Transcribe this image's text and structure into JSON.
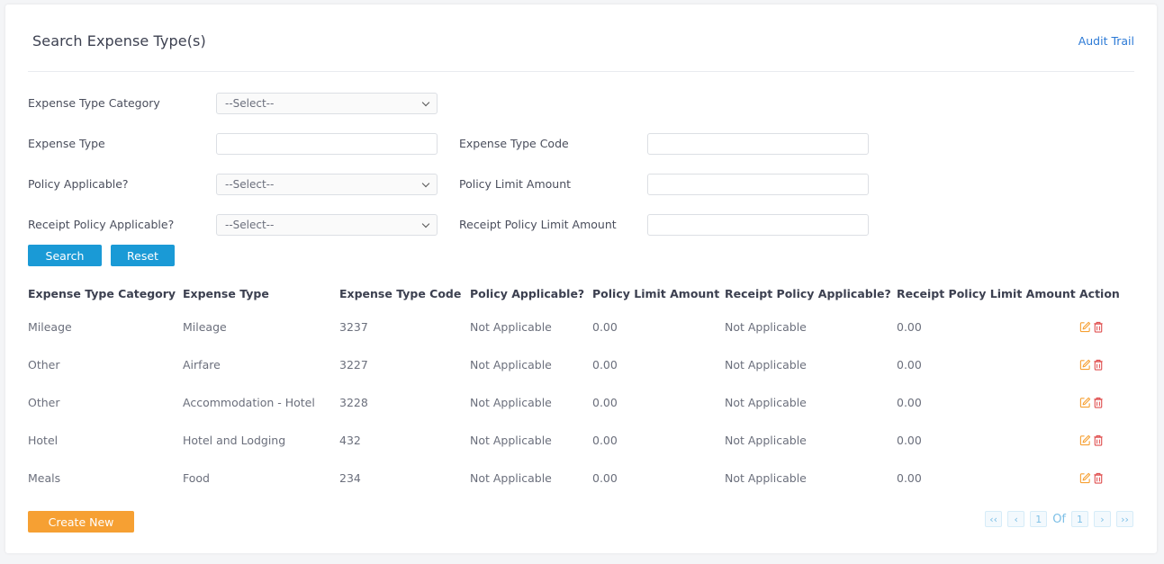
{
  "header": {
    "title": "Search Expense Type(s)",
    "audit_trail": "Audit Trail"
  },
  "form": {
    "expense_type_category": {
      "label": "Expense Type Category",
      "value": "--Select--"
    },
    "expense_type": {
      "label": "Expense Type",
      "value": ""
    },
    "expense_type_code": {
      "label": "Expense Type Code",
      "value": ""
    },
    "policy_applicable": {
      "label": "Policy Applicable?",
      "value": "--Select--"
    },
    "policy_limit_amount": {
      "label": "Policy Limit Amount",
      "value": ""
    },
    "receipt_policy_applicable": {
      "label": "Receipt Policy Applicable?",
      "value": "--Select--"
    },
    "receipt_policy_limit_amount": {
      "label": "Receipt Policy Limit Amount",
      "value": ""
    },
    "search_label": "Search",
    "reset_label": "Reset"
  },
  "table": {
    "columns": [
      "Expense Type Category",
      "Expense Type",
      "Expense Type Code",
      "Policy Applicable?",
      "Policy Limit Amount",
      "Receipt Policy Applicable?",
      "Receipt Policy Limit Amount",
      "Action"
    ],
    "rows": [
      [
        "Mileage",
        "Mileage",
        "3237",
        "Not Applicable",
        "0.00",
        "Not Applicable",
        "0.00"
      ],
      [
        "Other",
        "Airfare",
        "3227",
        "Not Applicable",
        "0.00",
        "Not Applicable",
        "0.00"
      ],
      [
        "Other",
        "Accommodation - Hotel",
        "3228",
        "Not Applicable",
        "0.00",
        "Not Applicable",
        "0.00"
      ],
      [
        "Hotel",
        "Hotel and Lodging",
        "432",
        "Not Applicable",
        "0.00",
        "Not Applicable",
        "0.00"
      ],
      [
        "Meals",
        "Food",
        "234",
        "Not Applicable",
        "0.00",
        "Not Applicable",
        "0.00"
      ]
    ],
    "action_icons": [
      "edit-icon",
      "delete-icon"
    ]
  },
  "footer": {
    "create_new_label": "Create New",
    "pagination": {
      "first": "‹‹",
      "prev": "‹",
      "current_page": "1",
      "of_label": "Of",
      "total_pages": "1",
      "next": "›",
      "last": "››"
    }
  },
  "colors": {
    "primary": "#1a9ad6",
    "accent": "#f6a033",
    "edit_icon": "#f6a033",
    "delete_icon": "#e05050",
    "link": "#2c7ad6"
  }
}
